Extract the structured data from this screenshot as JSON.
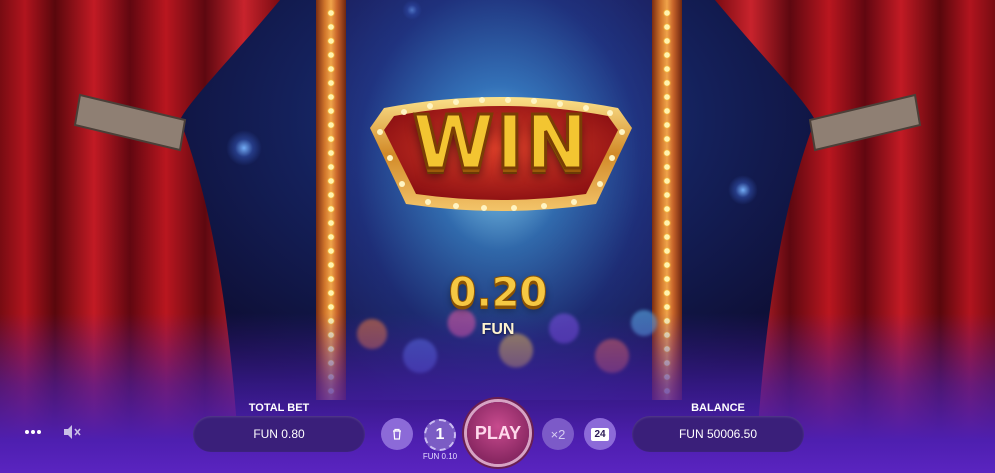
{
  "win": {
    "badge_text": "WIN",
    "amount": "0.20",
    "currency": "FUN"
  },
  "hud": {
    "total_bet_label": "TOTAL BET",
    "total_bet_value": "FUN 0.80",
    "coin_value": "1",
    "coin_caption": "FUN 0.10",
    "play_label": "PLAY",
    "multiplier_label": "×2",
    "autoplay_count": "24",
    "balance_label": "BALANCE",
    "balance_value": "FUN 50006.50",
    "menu_icon": "more-dots-icon",
    "mute_icon": "speaker-muted-icon",
    "clear_icon": "trash-icon"
  },
  "colors": {
    "gold": "#f3c531",
    "hud_pill": "#3a1f7a",
    "play_button": "#a8337a",
    "curtain_red": "#b1141e",
    "stage_purple": "#5a24c0"
  }
}
